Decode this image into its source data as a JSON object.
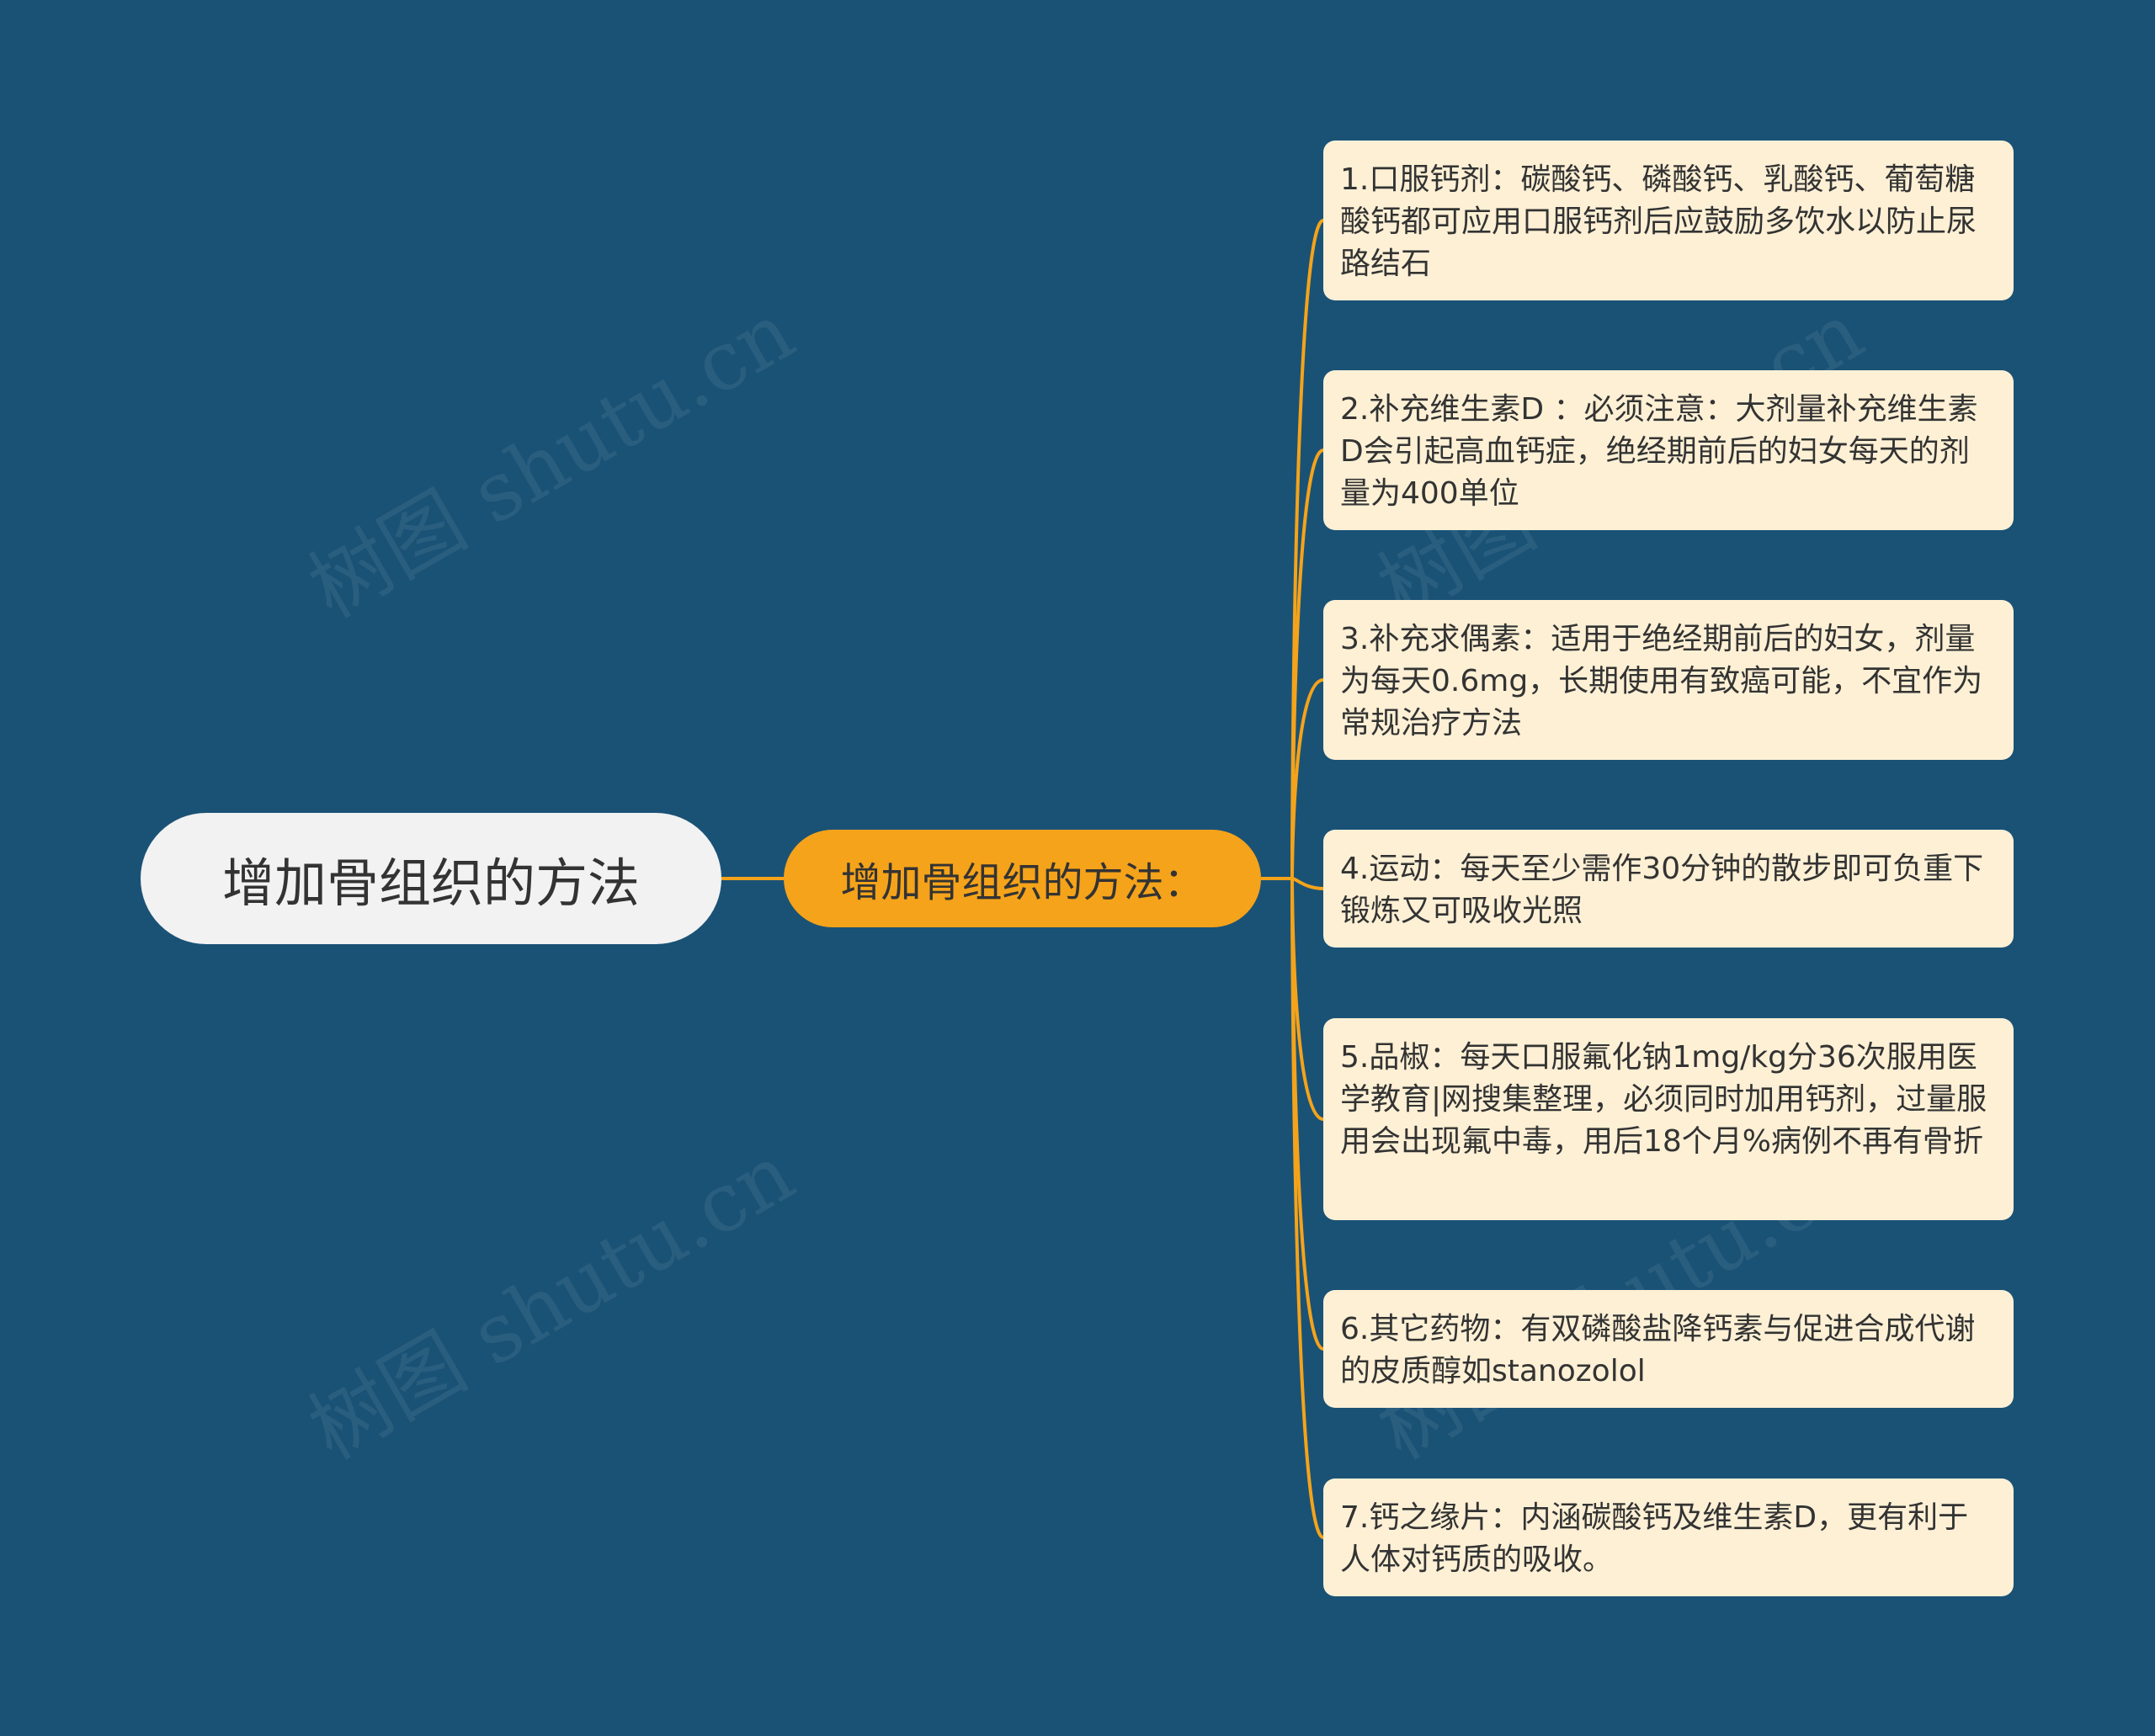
{
  "root": {
    "label": "增加骨组织的方法"
  },
  "hub": {
    "label": "增加骨组织的方法："
  },
  "items": [
    {
      "text": "1.口服钙剂：碳酸钙、磷酸钙、乳酸钙、葡萄糖酸钙都可应用口服钙剂后应鼓励多饮水以防止尿路结石"
    },
    {
      "text": "2.补充维生素D ：必须注意：大剂量补充维生素D会引起高血钙症，绝经期前后的妇女每天的剂量为400单位"
    },
    {
      "text": "3.补充求偶素：适用于绝经期前后的妇女，剂量为每天0.6mg，长期使用有致癌可能，不宜作为常规治疗方法"
    },
    {
      "text": "4.运动：每天至少需作30分钟的散步即可负重下锻炼又可吸收光照"
    },
    {
      "text": "5.品椒：每天口服氟化钠1mg/kg分36次服用医学教育|网搜集整理，必须同时加用钙剂，过量服用会出现氟中毒，用后18个月%病例不再有骨折"
    },
    {
      "text": "6.其它药物：有双磷酸盐降钙素与促进合成代谢的皮质醇如stanozolol"
    },
    {
      "text": "7.钙之缘片：内涵碳酸钙及维生素D，更有利于人体对钙质的吸收。"
    }
  ],
  "watermark": "树图 shutu.cn",
  "colors": {
    "background": "#1a5276",
    "root_fill": "#f2f2f2",
    "hub_fill": "#f5a31a",
    "leaf_fill": "#fdf0d5",
    "connector": "#f5a31a"
  }
}
